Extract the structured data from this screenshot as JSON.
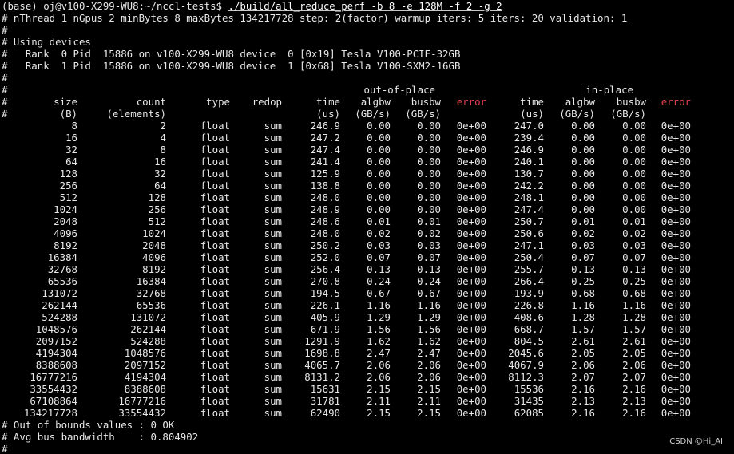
{
  "terminal": {
    "prompt": "(base) oj@v100-X299-WU8:~/nccl-tests$ ",
    "command": "./build/all_reduce_perf -b 8 -e 128M -f 2 -g 2",
    "preamble": [
      "# nThread 1 nGpus 2 minBytes 8 maxBytes 134217728 step: 2(factor) warmup iters: 5 iters: 20 validation: 1",
      "#",
      "# Using devices",
      "#   Rank  0 Pid  15886 on v100-X299-WU8 device  0 [0x19] Tesla V100-PCIE-32GB",
      "#   Rank  1 Pid  15886 on v100-X299-WU8 device  1 [0x68] Tesla V100-SXM2-16GB",
      "#"
    ],
    "group_headers": {
      "hash": "#",
      "out_of_place": "out-of-place",
      "in_place": "in-place"
    },
    "col_headers": [
      "#",
      "size",
      "count",
      "type",
      "redop",
      "time",
      "algbw",
      "busbw",
      "error",
      "time",
      "algbw",
      "busbw",
      "error"
    ],
    "unit_headers": [
      "#",
      "(B)",
      "(elements)",
      "",
      "",
      "(us)",
      "(GB/s)",
      "(GB/s)",
      "",
      "(us)",
      "(GB/s)",
      "(GB/s)",
      ""
    ],
    "rows": [
      [
        "8",
        "2",
        "float",
        "sum",
        "246.9",
        "0.00",
        "0.00",
        "0e+00",
        "247.0",
        "0.00",
        "0.00",
        "0e+00"
      ],
      [
        "16",
        "4",
        "float",
        "sum",
        "247.2",
        "0.00",
        "0.00",
        "0e+00",
        "239.4",
        "0.00",
        "0.00",
        "0e+00"
      ],
      [
        "32",
        "8",
        "float",
        "sum",
        "247.4",
        "0.00",
        "0.00",
        "0e+00",
        "246.9",
        "0.00",
        "0.00",
        "0e+00"
      ],
      [
        "64",
        "16",
        "float",
        "sum",
        "241.4",
        "0.00",
        "0.00",
        "0e+00",
        "240.1",
        "0.00",
        "0.00",
        "0e+00"
      ],
      [
        "128",
        "32",
        "float",
        "sum",
        "125.9",
        "0.00",
        "0.00",
        "0e+00",
        "130.7",
        "0.00",
        "0.00",
        "0e+00"
      ],
      [
        "256",
        "64",
        "float",
        "sum",
        "138.8",
        "0.00",
        "0.00",
        "0e+00",
        "242.2",
        "0.00",
        "0.00",
        "0e+00"
      ],
      [
        "512",
        "128",
        "float",
        "sum",
        "248.0",
        "0.00",
        "0.00",
        "0e+00",
        "248.1",
        "0.00",
        "0.00",
        "0e+00"
      ],
      [
        "1024",
        "256",
        "float",
        "sum",
        "248.9",
        "0.00",
        "0.00",
        "0e+00",
        "247.4",
        "0.00",
        "0.00",
        "0e+00"
      ],
      [
        "2048",
        "512",
        "float",
        "sum",
        "248.6",
        "0.01",
        "0.01",
        "0e+00",
        "250.7",
        "0.01",
        "0.01",
        "0e+00"
      ],
      [
        "4096",
        "1024",
        "float",
        "sum",
        "248.0",
        "0.02",
        "0.02",
        "0e+00",
        "250.6",
        "0.02",
        "0.02",
        "0e+00"
      ],
      [
        "8192",
        "2048",
        "float",
        "sum",
        "250.2",
        "0.03",
        "0.03",
        "0e+00",
        "247.1",
        "0.03",
        "0.03",
        "0e+00"
      ],
      [
        "16384",
        "4096",
        "float",
        "sum",
        "252.0",
        "0.07",
        "0.07",
        "0e+00",
        "250.4",
        "0.07",
        "0.07",
        "0e+00"
      ],
      [
        "32768",
        "8192",
        "float",
        "sum",
        "256.4",
        "0.13",
        "0.13",
        "0e+00",
        "255.7",
        "0.13",
        "0.13",
        "0e+00"
      ],
      [
        "65536",
        "16384",
        "float",
        "sum",
        "270.8",
        "0.24",
        "0.24",
        "0e+00",
        "266.4",
        "0.25",
        "0.25",
        "0e+00"
      ],
      [
        "131072",
        "32768",
        "float",
        "sum",
        "194.5",
        "0.67",
        "0.67",
        "0e+00",
        "193.9",
        "0.68",
        "0.68",
        "0e+00"
      ],
      [
        "262144",
        "65536",
        "float",
        "sum",
        "226.1",
        "1.16",
        "1.16",
        "0e+00",
        "226.8",
        "1.16",
        "1.16",
        "0e+00"
      ],
      [
        "524288",
        "131072",
        "float",
        "sum",
        "405.9",
        "1.29",
        "1.29",
        "0e+00",
        "408.6",
        "1.28",
        "1.28",
        "0e+00"
      ],
      [
        "1048576",
        "262144",
        "float",
        "sum",
        "671.9",
        "1.56",
        "1.56",
        "0e+00",
        "668.7",
        "1.57",
        "1.57",
        "0e+00"
      ],
      [
        "2097152",
        "524288",
        "float",
        "sum",
        "1291.9",
        "1.62",
        "1.62",
        "0e+00",
        "804.5",
        "2.61",
        "2.61",
        "0e+00"
      ],
      [
        "4194304",
        "1048576",
        "float",
        "sum",
        "1698.8",
        "2.47",
        "2.47",
        "0e+00",
        "2045.6",
        "2.05",
        "2.05",
        "0e+00"
      ],
      [
        "8388608",
        "2097152",
        "float",
        "sum",
        "4065.7",
        "2.06",
        "2.06",
        "0e+00",
        "4067.9",
        "2.06",
        "2.06",
        "0e+00"
      ],
      [
        "16777216",
        "4194304",
        "float",
        "sum",
        "8131.2",
        "2.06",
        "2.06",
        "0e+00",
        "8112.3",
        "2.07",
        "2.07",
        "0e+00"
      ],
      [
        "33554432",
        "8388608",
        "float",
        "sum",
        "15631",
        "2.15",
        "2.15",
        "0e+00",
        "15536",
        "2.16",
        "2.16",
        "0e+00"
      ],
      [
        "67108864",
        "16777216",
        "float",
        "sum",
        "31781",
        "2.11",
        "2.11",
        "0e+00",
        "31435",
        "2.13",
        "2.13",
        "0e+00"
      ],
      [
        "134217728",
        "33554432",
        "float",
        "sum",
        "62490",
        "2.15",
        "2.15",
        "0e+00",
        "62085",
        "2.16",
        "2.16",
        "0e+00"
      ]
    ],
    "footer": [
      "# Out of bounds values : 0 OK",
      "# Avg bus bandwidth    : 0.804902",
      "#"
    ],
    "watermark": "CSDN @Hi_AI"
  },
  "colors": {
    "background": "#000000",
    "foreground": "#e8e8e8",
    "error_header": "#e0444e"
  }
}
